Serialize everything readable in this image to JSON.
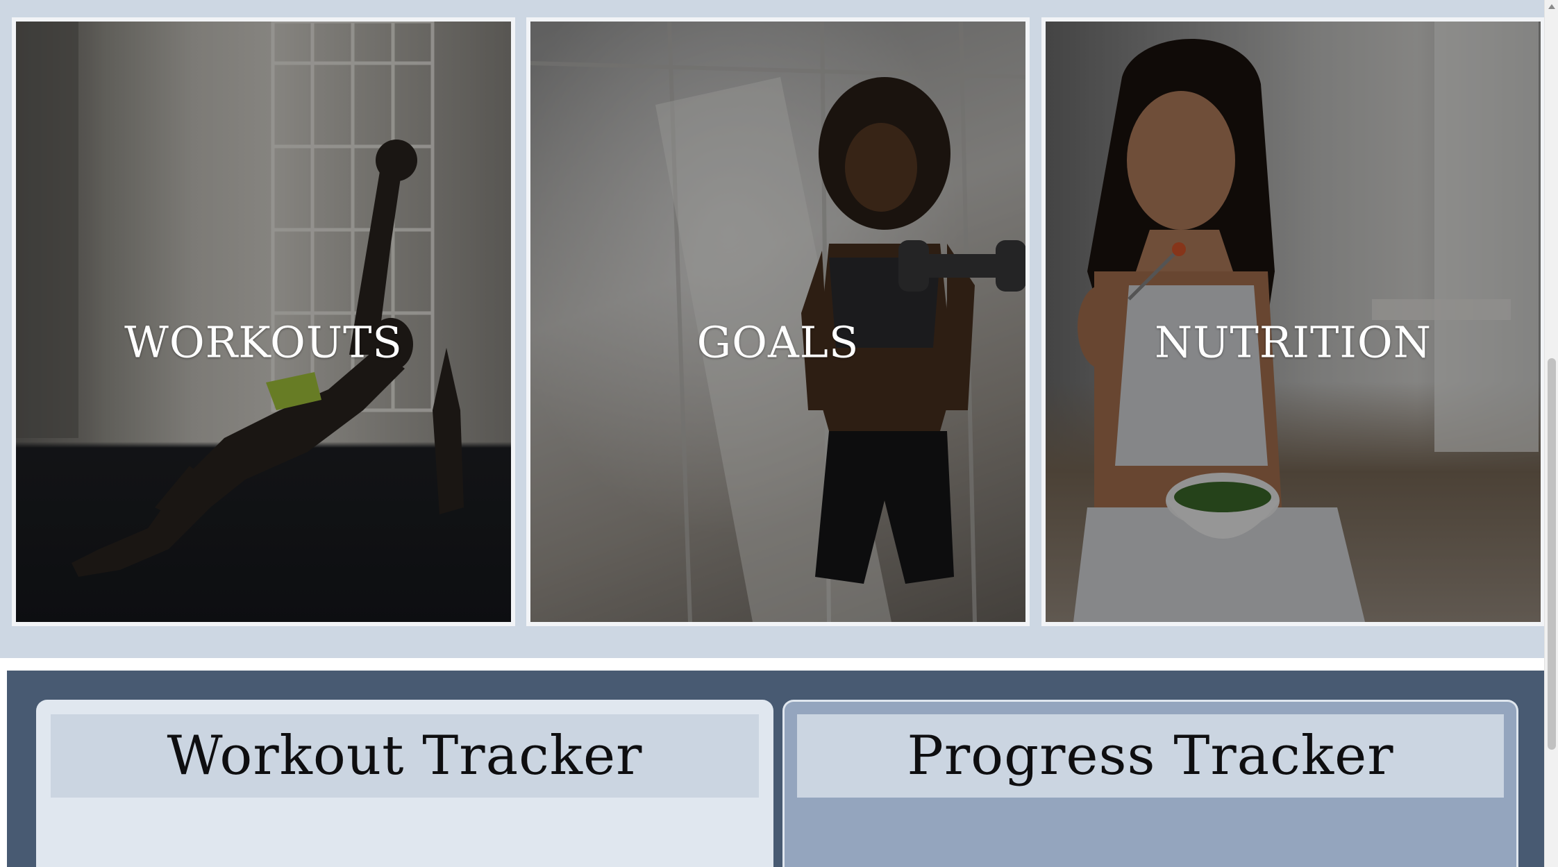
{
  "categories": [
    {
      "id": "workouts",
      "label": "WORKOUTS"
    },
    {
      "id": "goals",
      "label": "GOALS"
    },
    {
      "id": "nutrition",
      "label": "NUTRITION"
    }
  ],
  "trackers": {
    "workout": {
      "title": "Workout Tracker"
    },
    "progress": {
      "title": "Progress Tracker"
    }
  },
  "colors": {
    "cards_band_bg": "#cdd7e3",
    "tracker_band_bg": "#485a72",
    "workout_tracker_bg": "#e0e7ef",
    "progress_tracker_bg": "#94a5be",
    "tracker_header_bg": "#cbd5e1"
  }
}
